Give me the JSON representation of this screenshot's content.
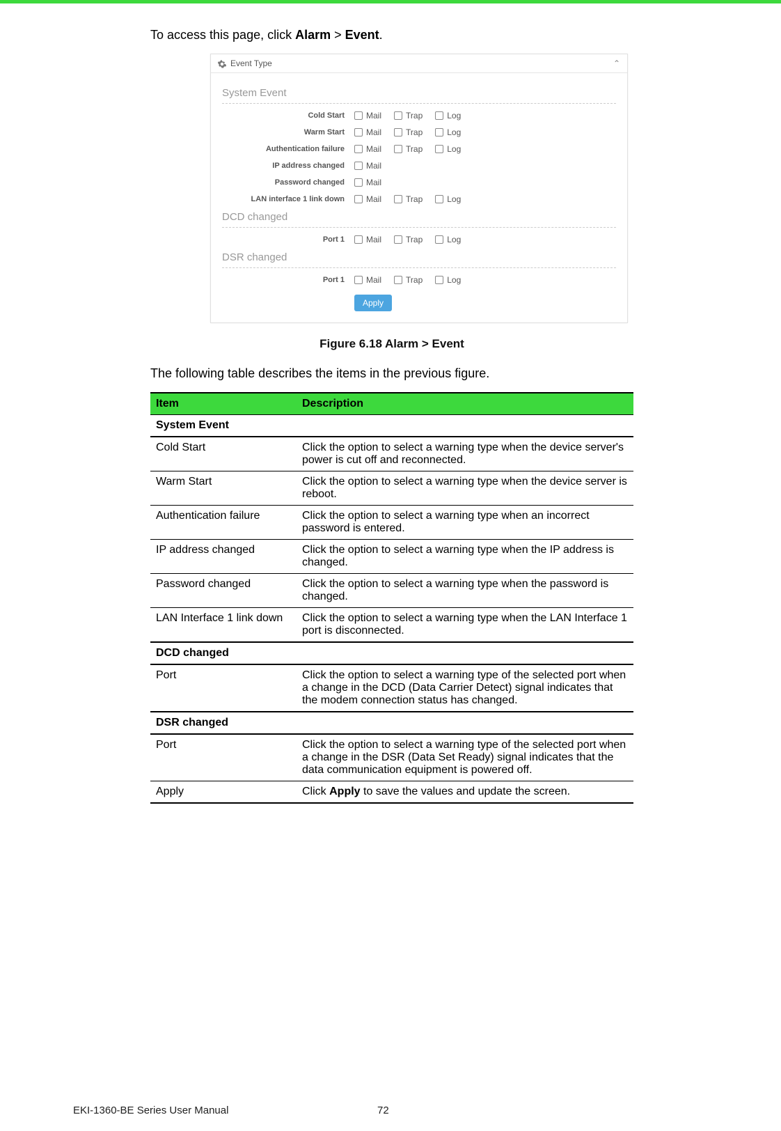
{
  "intro": {
    "prefix": "To access this page, click ",
    "bold1": "Alarm",
    "sep": " > ",
    "bold2": "Event",
    "suffix": "."
  },
  "panel": {
    "header_title": "Event Type",
    "sections": [
      {
        "title": "System Event",
        "rows": [
          {
            "label": "Cold Start",
            "options": [
              "Mail",
              "Trap",
              "Log"
            ]
          },
          {
            "label": "Warm Start",
            "options": [
              "Mail",
              "Trap",
              "Log"
            ]
          },
          {
            "label": "Authentication failure",
            "options": [
              "Mail",
              "Trap",
              "Log"
            ]
          },
          {
            "label": "IP address changed",
            "options": [
              "Mail"
            ]
          },
          {
            "label": "Password changed",
            "options": [
              "Mail"
            ]
          },
          {
            "label": "LAN interface 1 link down",
            "options": [
              "Mail",
              "Trap",
              "Log"
            ]
          }
        ]
      },
      {
        "title": "DCD changed",
        "rows": [
          {
            "label": "Port 1",
            "options": [
              "Mail",
              "Trap",
              "Log"
            ]
          }
        ]
      },
      {
        "title": "DSR changed",
        "rows": [
          {
            "label": "Port 1",
            "options": [
              "Mail",
              "Trap",
              "Log"
            ]
          }
        ]
      }
    ],
    "apply_label": "Apply"
  },
  "figure_caption": "Figure 6.18 Alarm > Event",
  "table_intro": "The following table describes the items in the previous figure.",
  "table": {
    "headers": [
      "Item",
      "Description"
    ],
    "rows": [
      {
        "type": "section",
        "item": "System Event",
        "desc": ""
      },
      {
        "type": "data",
        "item": "Cold Start",
        "desc": "Click the option to select a warning type when the device server's power is cut off and reconnected."
      },
      {
        "type": "data",
        "item": "Warm Start",
        "desc": "Click the option to select a warning type when the device server is reboot."
      },
      {
        "type": "data",
        "item": "Authentication failure",
        "desc": "Click the option to select a warning type when an incorrect password is entered."
      },
      {
        "type": "data",
        "item": "IP address changed",
        "desc": "Click the option to select a warning type when the IP address is changed."
      },
      {
        "type": "data",
        "item": "Password changed",
        "desc": "Click the option to select a warning type when the password is changed."
      },
      {
        "type": "data-heavy",
        "item": "LAN Interface 1 link down",
        "desc": "Click the option to select a warning type when the LAN Interface 1 port is disconnected."
      },
      {
        "type": "section",
        "item": "DCD changed",
        "desc": ""
      },
      {
        "type": "data-heavy",
        "item": "Port",
        "desc": "Click the option to select a warning type of the selected port when a change in the DCD (Data Carrier Detect) signal indicates that the modem connection status has changed."
      },
      {
        "type": "section",
        "item": "DSR changed",
        "desc": ""
      },
      {
        "type": "data",
        "item": "Port",
        "desc": "Click the option to select a warning type of the selected port when a change in the DSR (Data Set Ready) signal indicates that the data communication equipment is powered off."
      },
      {
        "type": "data",
        "item": "Apply",
        "desc_prefix": "Click ",
        "desc_bold": "Apply",
        "desc_suffix": " to save the values and update the screen."
      }
    ]
  },
  "footer": {
    "manual_title": "EKI-1360-BE Series User Manual",
    "page_num": "72"
  }
}
